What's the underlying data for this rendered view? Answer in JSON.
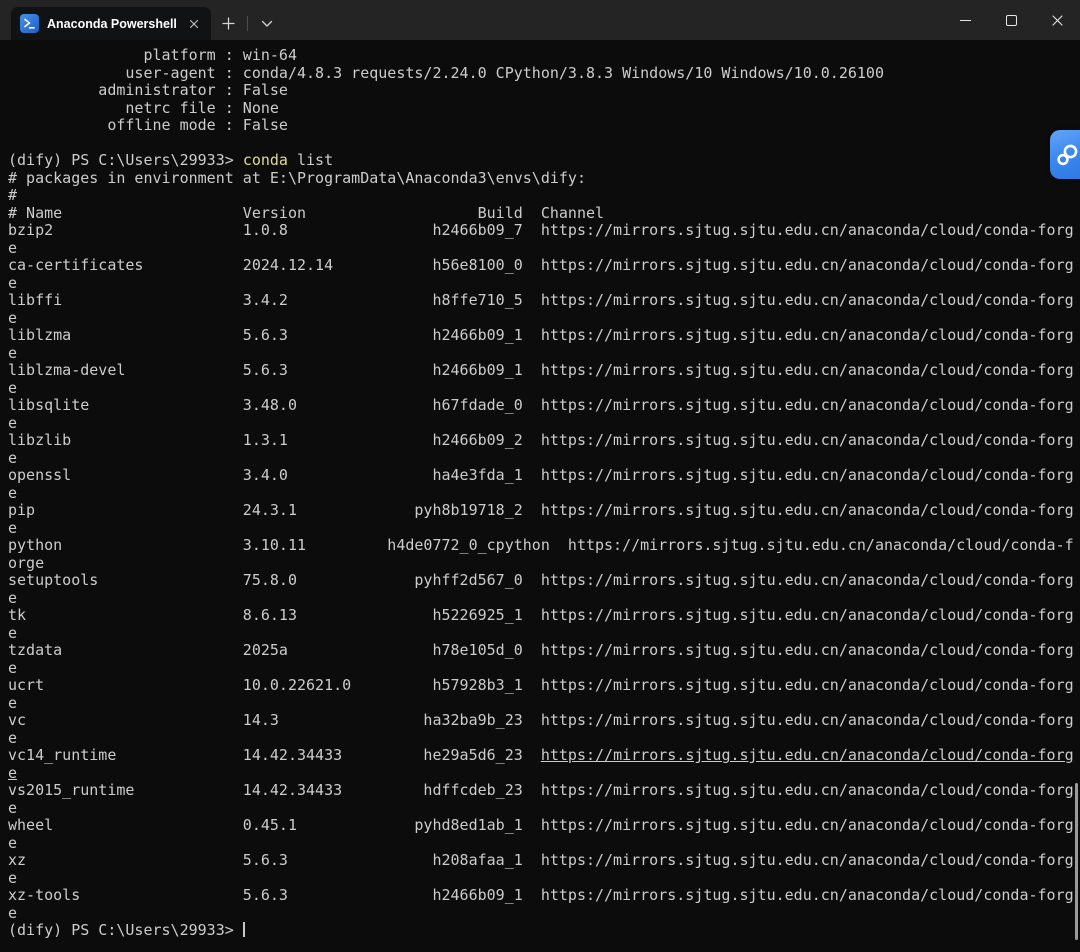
{
  "window": {
    "tab_title": "Anaconda Powershell Pr",
    "icons": {
      "tab_program": "powershell-icon",
      "tab_close": "close-icon",
      "new_tab": "plus-icon",
      "tab_dropdown": "chevron-down-icon",
      "minimize": "minimize-icon",
      "maximize": "maximize-icon",
      "close": "close-icon"
    }
  },
  "terminal": {
    "colors": {
      "background": "#0c0c0c",
      "foreground": "#cccccc",
      "command": "#dfdb8e",
      "titlebar": "#242424",
      "tab": "#111213",
      "assistant_blue": "#3a86ef"
    },
    "info_key_width": 23,
    "info": [
      {
        "key": "platform",
        "value": "win-64"
      },
      {
        "key": "user-agent",
        "value": "conda/4.8.3 requests/2.24.0 CPython/3.8.3 Windows/10 Windows/10.0.26100"
      },
      {
        "key": "administrator",
        "value": "False"
      },
      {
        "key": "netrc file",
        "value": "None"
      },
      {
        "key": "offline mode",
        "value": "False"
      }
    ],
    "prompt": "(dify) PS C:\\Users\\29933> ",
    "command_program": "conda",
    "command_args": " list",
    "env_line": "# packages in environment at E:\\ProgramData\\Anaconda3\\envs\\dify:",
    "comment_line": "#",
    "columns": {
      "name": "# Name",
      "version": "Version",
      "build": "Build",
      "channel": "Channel"
    },
    "field_widths": {
      "name": 25,
      "version": 15,
      "build": 15,
      "gap": 2
    },
    "wrap_columns": 118,
    "channel_url": "https://mirrors.sjtug.sjtu.edu.cn/anaconda/cloud/conda-forge",
    "packages": [
      {
        "name": "bzip2",
        "version": "1.0.8",
        "build": "h2466b09_7"
      },
      {
        "name": "ca-certificates",
        "version": "2024.12.14",
        "build": "h56e8100_0"
      },
      {
        "name": "libffi",
        "version": "3.4.2",
        "build": "h8ffe710_5"
      },
      {
        "name": "liblzma",
        "version": "5.6.3",
        "build": "h2466b09_1"
      },
      {
        "name": "liblzma-devel",
        "version": "5.6.3",
        "build": "h2466b09_1"
      },
      {
        "name": "libsqlite",
        "version": "3.48.0",
        "build": "h67fdade_0"
      },
      {
        "name": "libzlib",
        "version": "1.3.1",
        "build": "h2466b09_2"
      },
      {
        "name": "openssl",
        "version": "3.4.0",
        "build": "ha4e3fda_1"
      },
      {
        "name": "pip",
        "version": "24.3.1",
        "build": "pyh8b19718_2"
      },
      {
        "name": "python",
        "version": "3.10.11",
        "build": "h4de0772_0_cpython"
      },
      {
        "name": "setuptools",
        "version": "75.8.0",
        "build": "pyhff2d567_0"
      },
      {
        "name": "tk",
        "version": "8.6.13",
        "build": "h5226925_1"
      },
      {
        "name": "tzdata",
        "version": "2025a",
        "build": "h78e105d_0"
      },
      {
        "name": "ucrt",
        "version": "10.0.22621.0",
        "build": "h57928b3_1"
      },
      {
        "name": "vc",
        "version": "14.3",
        "build": "ha32ba9b_23"
      },
      {
        "name": "vc14_runtime",
        "version": "14.42.34433",
        "build": "he29a5d6_23",
        "underline": true
      },
      {
        "name": "vs2015_runtime",
        "version": "14.42.34433",
        "build": "hdffcdeb_23"
      },
      {
        "name": "wheel",
        "version": "0.45.1",
        "build": "pyhd8ed1ab_1"
      },
      {
        "name": "xz",
        "version": "5.6.3",
        "build": "h208afaa_1"
      },
      {
        "name": "xz-tools",
        "version": "5.6.3",
        "build": "h2466b09_1"
      }
    ],
    "closing_prompt": "(dify) PS C:\\Users\\29933> "
  }
}
